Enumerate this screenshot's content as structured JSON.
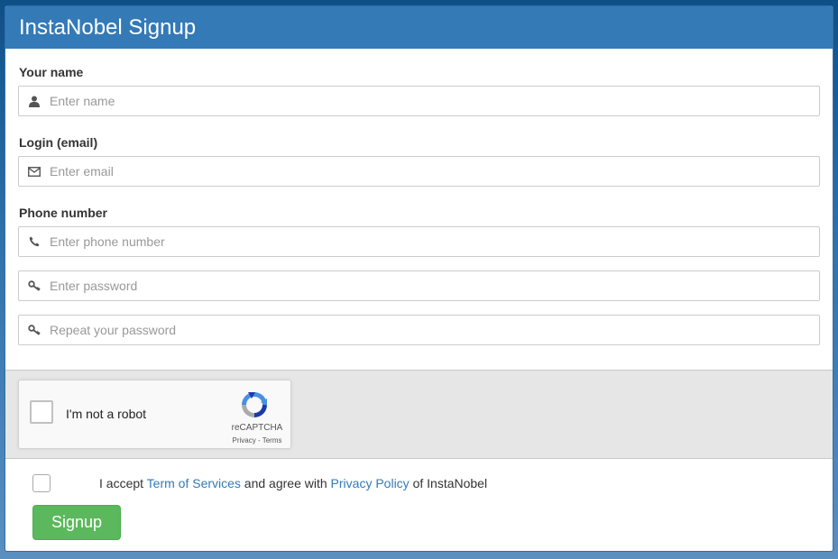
{
  "header": {
    "title": "InstaNobel Signup"
  },
  "form": {
    "name": {
      "label": "Your name",
      "placeholder": "Enter name",
      "value": "",
      "icon": "user-icon"
    },
    "email": {
      "label": "Login (email)",
      "placeholder": "Enter email",
      "value": "",
      "icon": "envelope-icon"
    },
    "phone": {
      "label": "Phone number",
      "placeholder": "Enter phone number",
      "value": "",
      "icon": "phone-icon"
    },
    "password": {
      "placeholder": "Enter password",
      "value": "",
      "icon": "key-icon"
    },
    "password_repeat": {
      "placeholder": "Repeat your password",
      "value": "",
      "icon": "key-icon"
    }
  },
  "captcha": {
    "label": "I'm not a robot",
    "brand": "reCAPTCHA",
    "links": "Privacy - Terms"
  },
  "terms": {
    "prefix": "I accept ",
    "tos_link": "Term of Services",
    "middle": " and agree with ",
    "privacy_link": "Privacy Policy",
    "suffix": " of InstaNobel"
  },
  "signup_button": "Signup",
  "colors": {
    "header_bg": "#337ab7",
    "link": "#337ab7",
    "button_bg": "#5cb85c"
  }
}
